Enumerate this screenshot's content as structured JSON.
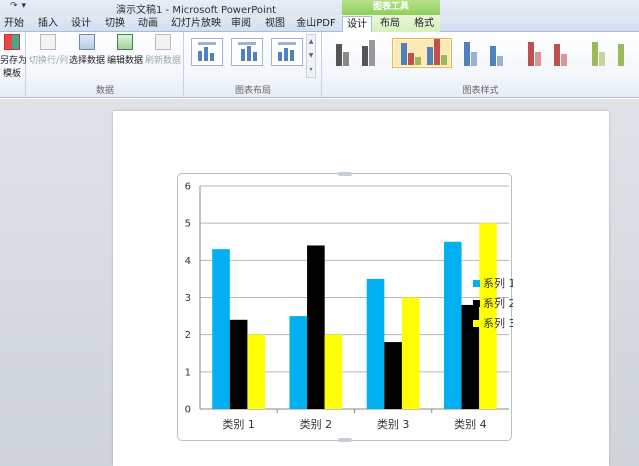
{
  "window": {
    "title": "演示文稿1 - Microsoft PowerPoint",
    "context_tab_group": "图表工具"
  },
  "tabs": [
    {
      "label": "开始",
      "active": false
    },
    {
      "label": "插入",
      "active": false
    },
    {
      "label": "设计",
      "active": false
    },
    {
      "label": "切换",
      "active": false
    },
    {
      "label": "动画",
      "active": false
    },
    {
      "label": "幻灯片放映",
      "active": false
    },
    {
      "label": "审阅",
      "active": false
    },
    {
      "label": "视图",
      "active": false
    },
    {
      "label": "金山PDF",
      "active": false
    },
    {
      "label": "设计",
      "active": true
    },
    {
      "label": "布局",
      "active": false
    },
    {
      "label": "格式",
      "active": false
    }
  ],
  "ribbon": {
    "type_group": {
      "save_as_template_line1": "另存为",
      "save_as_template_line2": "模板"
    },
    "data_group": {
      "label": "数据",
      "buttons": [
        {
          "label": "切换行/列",
          "enabled": false
        },
        {
          "label": "选择数据",
          "enabled": true
        },
        {
          "label": "编辑数据",
          "enabled": true
        },
        {
          "label": "刷新数据",
          "enabled": false
        }
      ]
    },
    "layout_group": {
      "label": "图表布局"
    },
    "style_group": {
      "label": "图表样式"
    }
  },
  "colors": {
    "series1": "#00b0f0",
    "series2": "#000000",
    "series3": "#ffff00",
    "accent_green": "#8fcf5a",
    "ribbon_border": "#a9bcd8"
  },
  "icons": {
    "qat": [
      "redo-icon",
      "customize-qat-icon"
    ],
    "ribbon": [
      "switch-row-column-icon",
      "select-data-icon",
      "edit-data-icon",
      "refresh-data-icon",
      "save-as-template-icon"
    ]
  },
  "chart_data": {
    "type": "bar",
    "categories": [
      "类别 1",
      "类别 2",
      "类别 3",
      "类别 4"
    ],
    "series": [
      {
        "name": "系列 1",
        "values": [
          4.3,
          2.5,
          3.5,
          4.5
        ]
      },
      {
        "name": "系列 2",
        "values": [
          2.4,
          4.4,
          1.8,
          2.8
        ]
      },
      {
        "name": "系列 3",
        "values": [
          2,
          2,
          3,
          5
        ]
      }
    ],
    "ylim": [
      0,
      6
    ],
    "yticks": [
      "0",
      "1",
      "2",
      "3",
      "4",
      "5",
      "6"
    ],
    "grid": true,
    "legend": "right"
  }
}
